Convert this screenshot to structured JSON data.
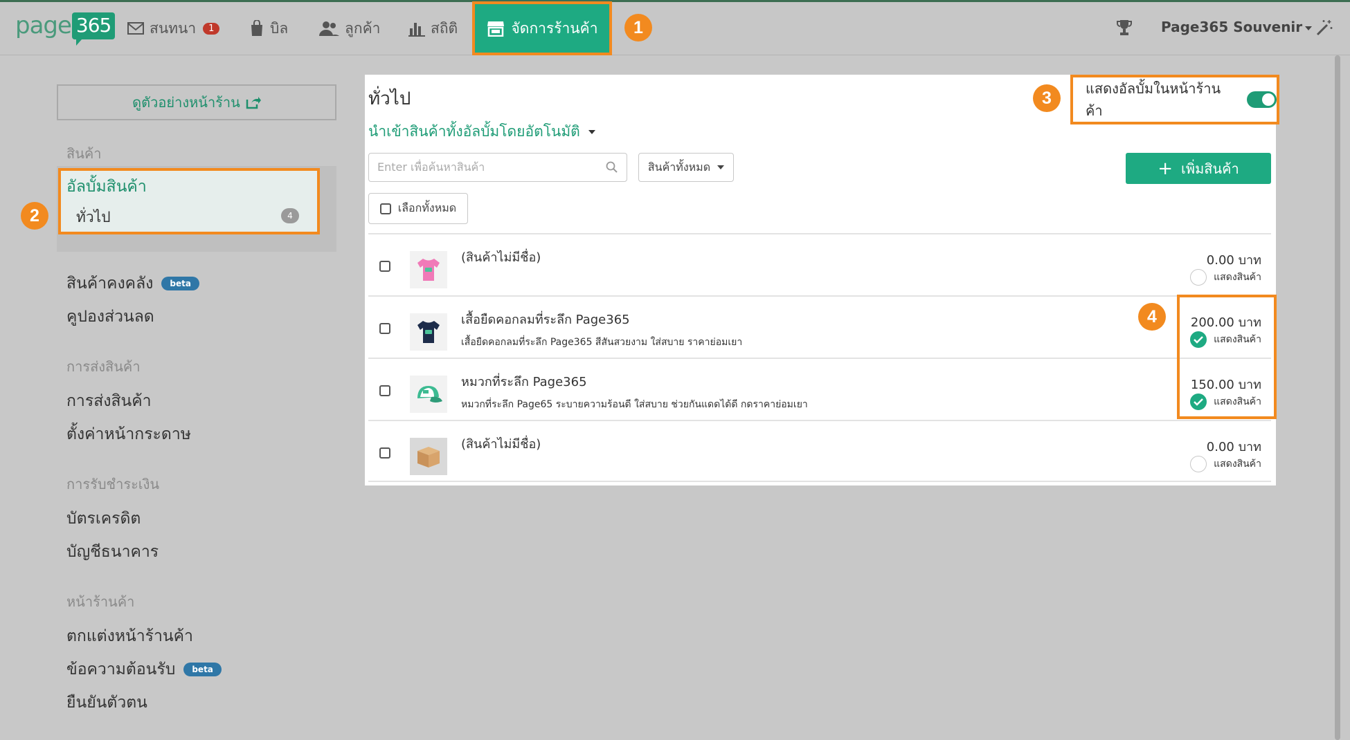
{
  "header": {
    "logo_text": "page",
    "logo_bubble": "365",
    "nav": [
      {
        "label": "สนทนา",
        "badge": "1",
        "icon": "envelope-icon"
      },
      {
        "label": "บิล",
        "icon": "bag-icon"
      },
      {
        "label": "ลูกค้า",
        "icon": "users-icon"
      },
      {
        "label": "สถิติ",
        "icon": "chart-icon"
      }
    ],
    "active_nav": {
      "label": "จัดการร้านค้า",
      "icon": "store-icon"
    },
    "store_name": "Page365 Souvenir"
  },
  "callouts": [
    "1",
    "2",
    "3",
    "4"
  ],
  "sidebar": {
    "preview_button": "ดูตัวอย่างหน้าร้าน",
    "sections": [
      {
        "label": "สินค้า"
      },
      {
        "label": "การส่งสินค้า"
      },
      {
        "label": "การรับชำระเงิน"
      },
      {
        "label": "หน้าร้านค้า"
      }
    ],
    "album_title": "อัลบั้มสินค้า",
    "album_item": "ทั่วไป",
    "album_count": "4",
    "links": {
      "stock": "สินค้าคงคลัง",
      "coupon": "คูปองส่วนลด",
      "shipping": "การส่งสินค้า",
      "paper": "ตั้งค่าหน้ากระดาษ",
      "credit": "บัตรเครดิต",
      "bank": "บัญชีธนาคาร",
      "decorate": "ตกแต่งหน้าร้านค้า",
      "welcome": "ข้อความต้อนรับ",
      "verify": "ยืนยันตัวตน"
    },
    "beta_label": "beta"
  },
  "main": {
    "title": "ทั่วไป",
    "import_link": "นำเข้าสินค้าทั้งอัลบั้มโดยอัตโนมัติ",
    "toggle_label": "แสดงอัลบั้มในหน้าร้านค้า",
    "toggle_on": true,
    "search_placeholder": "Enter เพื่อค้นหาสินค้า",
    "filter_label": "สินค้าทั้งหมด",
    "add_button": "เพิ่มสินค้า",
    "select_all": "เลือกทั้งหมด",
    "products": [
      {
        "name": "(สินค้าไม่มีชื่อ)",
        "desc": "",
        "price": "0.00 บาท",
        "show_label": "แสดงสินค้า",
        "shown": false,
        "thumb": "pink-shirt-icon"
      },
      {
        "name": "เสื้อยืดคอกลมที่ระลึก Page365",
        "desc": "เสื้อยืดคอกลมที่ระลึก Page365 สีสันสวยงาม ใส่สบาย ราคาย่อมเยา",
        "price": "200.00 บาท",
        "show_label": "แสดงสินค้า",
        "shown": true,
        "thumb": "navy-shirt-icon"
      },
      {
        "name": "หมวกที่ระลึก Page365",
        "desc": "หมวกที่ระลึก Page65 ระบายความร้อนดี ใส่สบาย ช่วยกันแดดได้ดี กดราคาย่อมเยา",
        "price": "150.00 บาท",
        "show_label": "แสดงสินค้า",
        "shown": true,
        "thumb": "cap-icon"
      },
      {
        "name": "(สินค้าไม่มีชื่อ)",
        "desc": "",
        "price": "0.00 บาท",
        "show_label": "แสดงสินค้า",
        "shown": false,
        "thumb": "box-icon"
      }
    ]
  },
  "colors": {
    "accent": "#1eaa82",
    "highlight": "#f28a1f",
    "badge": "#c0392b",
    "beta": "#2f77a7"
  }
}
